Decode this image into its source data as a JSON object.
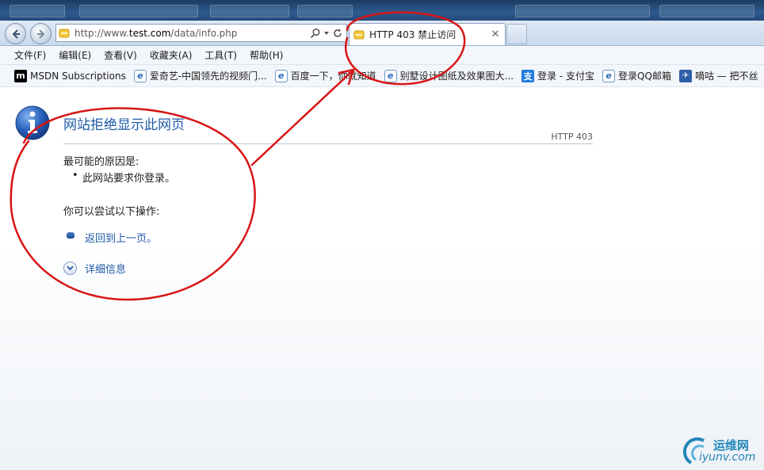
{
  "window": {
    "accent": "#1f5aa7"
  },
  "address_bar": {
    "url_prefix": "http://www.",
    "url_domain": "test.com",
    "url_path": "/data/info.php"
  },
  "tab": {
    "title": "HTTP 403 禁止访问"
  },
  "menu": [
    "文件(F)",
    "编辑(E)",
    "查看(V)",
    "收藏夹(A)",
    "工具(T)",
    "帮助(H)"
  ],
  "favorites": [
    {
      "label": "MSDN Subscriptions",
      "icon": "msdn-icon"
    },
    {
      "label": "爱奇艺-中国领先的视频门...",
      "icon": "ie-page-icon"
    },
    {
      "label": "百度一下，你就知道",
      "icon": "ie-page-icon"
    },
    {
      "label": "别墅设计图纸及效果图大...",
      "icon": "ie-page-icon"
    },
    {
      "label": "登录 - 支付宝",
      "icon": "alipay-icon"
    },
    {
      "label": "登录QQ邮箱",
      "icon": "ie-page-icon"
    },
    {
      "label": "嘀咕 — 把不丝",
      "icon": "digu-icon"
    }
  ],
  "error_page": {
    "title": "网站拒绝显示此网页",
    "code": "HTTP 403",
    "cause_heading": "最可能的原因是:",
    "cause_item": "此网站要求你登录。",
    "try_heading": "你可以尝试以下操作:",
    "back_link": "返回到上一页。",
    "details_link": "详细信息"
  },
  "watermark": {
    "cn": "运维网",
    "en": "iyunv.com"
  },
  "annotation_color": "#d81414"
}
